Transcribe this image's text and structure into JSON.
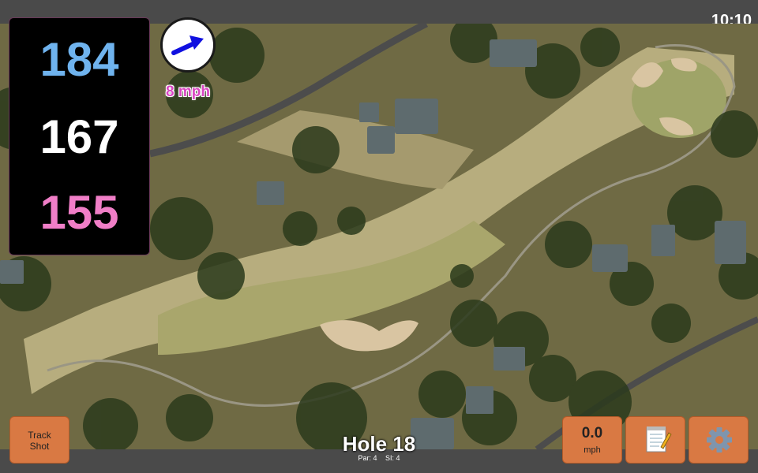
{
  "status_bar": {
    "time": "10:10"
  },
  "distances": {
    "back": "184",
    "middle": "167",
    "front": "155"
  },
  "wind": {
    "speed_label": "8 mph",
    "direction_icon": "wind-arrow-icon",
    "arrow_color": "#1010e0"
  },
  "hole": {
    "title": "Hole 18",
    "par": "Par: 4",
    "si": "SI: 4"
  },
  "buttons": {
    "track_shot_line1": "Track",
    "track_shot_line2": "Shot",
    "wind_value": "0.0",
    "wind_unit": "mph",
    "notes_icon": "notepad-icon",
    "settings_icon": "gear-icon"
  },
  "colors": {
    "back_distance": "#6fb3ee",
    "middle_distance": "#ffffff",
    "front_distance": "#f07ec7",
    "button_bg": "#d97943",
    "wind_text": "#d946c3"
  }
}
